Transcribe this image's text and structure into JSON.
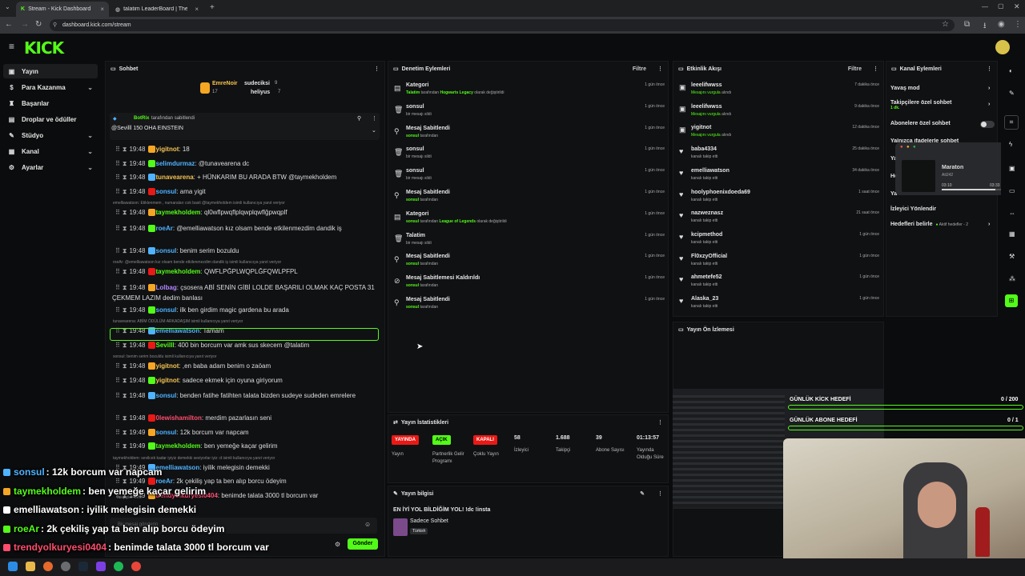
{
  "browser": {
    "tabs": [
      {
        "title": "Stream - Kick Dashboard",
        "active": true
      },
      {
        "title": "talatim LeaderBoard | The best",
        "active": false
      }
    ],
    "url": "dashboard.kick.com/stream"
  },
  "header": {
    "logo": "KICK"
  },
  "sidebar": {
    "items": [
      {
        "label": "Yayın",
        "icon": "video-icon",
        "active": true,
        "chevron": false
      },
      {
        "label": "Para Kazanma",
        "icon": "money-icon",
        "chevron": true
      },
      {
        "label": "Başarılar",
        "icon": "trophy-icon",
        "chevron": false
      },
      {
        "label": "Droplar ve ödüller",
        "icon": "gift-icon",
        "chevron": false
      },
      {
        "label": "Stüdyo",
        "icon": "studio-icon",
        "chevron": true
      },
      {
        "label": "Kanal",
        "icon": "channel-icon",
        "chevron": true
      },
      {
        "label": "Ayarlar",
        "icon": "settings-icon",
        "chevron": true
      }
    ]
  },
  "chat": {
    "title": "Sohbet",
    "leaderboard": [
      {
        "name": "EmreNoir",
        "value": "17"
      },
      {
        "name": "sudeciksi",
        "value": "9"
      },
      {
        "name": "heliyus",
        "value": "7"
      }
    ],
    "pinned": {
      "bot": "BotRix",
      "by": "tarafından sabitlendi",
      "text": "@Sevilll 150 OHA EINSTEIN"
    },
    "messages": [
      {
        "time": "19:48",
        "user": "yigitnot",
        "color": "#f5c451",
        "text": "18",
        "reply": ""
      },
      {
        "time": "19:48",
        "user": "selimdurmaz",
        "color": "#4fb3ff",
        "text": "@tunavearena dc",
        "reply": ""
      },
      {
        "time": "19:48",
        "user": "tunavearena",
        "color": "#f5c451",
        "text": "+ HÜNKARIM BU ARADA BTW @taymekholdem",
        "reply": ""
      },
      {
        "time": "19:48",
        "user": "sonsul",
        "color": "#4fb3ff",
        "text": "ama yigit",
        "reply": ""
      },
      {
        "time": "19:48",
        "user": "taymekholdem",
        "color": "#53fc18",
        "text": "ql0wflpwqflplqwplqwflğpwqplf",
        "reply": "emelliawatson: Etiklenmem , numaraları cok basit @taymekholdem isimli kullanıcıya yanıt veriyor"
      },
      {
        "time": "19:48",
        "user": "roeAr",
        "color": "#4fb3ff",
        "text": "@emelliawatson kız olsam bende etkilenmezdim dandik iş",
        "reply": ""
      },
      {
        "time": "19:48",
        "user": "sonsul",
        "color": "#4fb3ff",
        "text": "benim serim bozuldu",
        "reply": ""
      },
      {
        "time": "19:48",
        "user": "taymekholdem",
        "color": "#53fc18",
        "text": "QWFLPĞPLWQPLĞFQWLPFPL",
        "reply": "roeAr: @emelliawatson kız olsam bende etkilenmezdim dandik iş isimli kullanıcıya yanıt veriyor"
      },
      {
        "time": "19:48",
        "user": "Lolbag",
        "color": "#b388ff",
        "text": "çsosera ABİ SENİN GİBİ LOLDE BAŞARILI OLMAK KAÇ POSTA 31 ÇEKMEM LAZIM dedim banlası",
        "reply": ""
      },
      {
        "time": "19:48",
        "user": "sonsul",
        "color": "#4fb3ff",
        "text": "ilk ben girdim magic gardena bu arada",
        "reply": ""
      },
      {
        "time": "19:48",
        "user": "emelliawatson",
        "color": "#4fb3ff",
        "text": "Tamam",
        "reply": "tunavearena: ABİM ÖDÜLÜM ARKADAŞIM isimli kullanıcıya yanıt veriyor"
      },
      {
        "time": "19:48",
        "user": "Sevilll",
        "color": "#53fc18",
        "text": "400 bin borcum var amk sus skecem @talatim",
        "reply": ""
      },
      {
        "time": "19:48",
        "user": "yigitnot",
        "color": "#f5c451",
        "text": ",en baba adam benim o zaöam",
        "reply": "sonsul: benim serim bozuldu isimli kullanıcıya yanıt veriyor"
      },
      {
        "time": "19:48",
        "user": "yigitnot",
        "color": "#f5c451",
        "text": "sadece ekmek için oyuna giriyorum",
        "reply": ""
      },
      {
        "time": "19:48",
        "user": "sonsul",
        "color": "#4fb3ff",
        "text": "benden fatihe fatihten talata bizden sudeye sudeden emrelere",
        "reply": ""
      },
      {
        "time": "19:48",
        "user": "0lewishamilton",
        "color": "#ff4d6d",
        "text": "merdim pazarlasın seni",
        "reply": ""
      },
      {
        "time": "19:49",
        "user": "sonsul",
        "color": "#4fb3ff",
        "text": "12k borcum var napcam",
        "reply": ""
      },
      {
        "time": "19:49",
        "user": "taymekholdem",
        "color": "#53fc18",
        "text": "ben yemeğe kaçar gelirim",
        "reply": ""
      },
      {
        "time": "19:49",
        "user": "emelliawatson",
        "color": "#4fb3ff",
        "text": "iyilik melegisin demekki",
        "reply": "taymekholdem: sevilcek kadar iyiyiz demekki seviyorlar iyiz :d isimli kullanıcıya yanıt veriyor"
      },
      {
        "time": "19:49",
        "user": "roeAr",
        "color": "#4fb3ff",
        "text": "2k çekiliş yap ta ben alıp borcu ödeyim",
        "reply": ""
      },
      {
        "time": "19:49",
        "user": "trendyolkuryesi0404",
        "color": "#ff4d6d",
        "text": "benimde talata 3000 tl borcum var",
        "reply": ""
      }
    ],
    "input_placeholder": "Bir mesaj gönderin",
    "send_label": "Gönder",
    "footer_user": "Takipçiler Özel"
  },
  "moderation": {
    "title": "Denetim Eylemleri",
    "filter": "Filtre",
    "rows": [
      {
        "icon": "category-icon",
        "action": "Kategori",
        "sub_user": "Talatim",
        "sub_text": "tarafından",
        "sub_extra": "Hogwarts Legacy",
        "sub_tail": "olarak değiştirildi",
        "time": "1 gün önce"
      },
      {
        "icon": "trash-icon",
        "action": "sonsul",
        "sub_user": "",
        "sub_text": "bir mesajı sildi",
        "sub_extra": "",
        "sub_tail": "",
        "time": "1 gün önce"
      },
      {
        "icon": "pin-icon",
        "action": "Mesaj Sabitlendi",
        "sub_user": "sonsul",
        "sub_text": "tarafından",
        "sub_extra": "",
        "sub_tail": "",
        "time": "1 gün önce"
      },
      {
        "icon": "trash-icon",
        "action": "sonsul",
        "sub_user": "",
        "sub_text": "bir mesajı sildi",
        "sub_extra": "",
        "sub_tail": "",
        "time": "1 gün önce"
      },
      {
        "icon": "trash-icon",
        "action": "sonsul",
        "sub_user": "",
        "sub_text": "bir mesajı sildi",
        "sub_extra": "",
        "sub_tail": "",
        "time": "1 gün önce"
      },
      {
        "icon": "pin-icon",
        "action": "Mesaj Sabitlendi",
        "sub_user": "sonsul",
        "sub_text": "tarafından",
        "sub_extra": "",
        "sub_tail": "",
        "time": "1 gün önce"
      },
      {
        "icon": "category-icon",
        "action": "Kategori",
        "sub_user": "sonsul",
        "sub_text": "tarafından",
        "sub_extra": "League of Legends",
        "sub_tail": "olarak değiştirildi",
        "time": "1 gün önce"
      },
      {
        "icon": "trash-icon",
        "action": "Talatim",
        "sub_user": "",
        "sub_text": "bir mesajı sildi",
        "sub_extra": "",
        "sub_tail": "",
        "time": "1 gün önce"
      },
      {
        "icon": "pin-icon",
        "action": "Mesaj Sabitlendi",
        "sub_user": "sonsul",
        "sub_text": "tarafından",
        "sub_extra": "",
        "sub_tail": "",
        "time": "1 gün önce"
      },
      {
        "icon": "unpin-icon",
        "action": "Mesaj Sabitlemesi Kaldırıldı",
        "sub_user": "sonsul",
        "sub_text": "tarafından",
        "sub_extra": "",
        "sub_tail": "",
        "time": "1 gün önce"
      },
      {
        "icon": "pin-icon",
        "action": "Mesaj Sabitlendi",
        "sub_user": "sonsul",
        "sub_text": "tarafından",
        "sub_extra": "",
        "sub_tail": "",
        "time": "1 gün önce"
      }
    ]
  },
  "activity": {
    "title": "Etkinlik Akışı",
    "filter": "Filtre",
    "rows": [
      {
        "icon": "message-icon",
        "user": "leeelifwwss",
        "sub": "Mesajını vurgula",
        "sub_tail": "alındı",
        "time": "7 dakika önce"
      },
      {
        "icon": "message-icon",
        "user": "leeelifwwss",
        "sub": "Mesajını vurgula",
        "sub_tail": "alındı",
        "time": "9 dakika önce"
      },
      {
        "icon": "message-icon",
        "user": "yigitnot",
        "sub": "Mesajını vurgula",
        "sub_tail": "alındı",
        "time": "12 dakika önce"
      },
      {
        "icon": "heart-icon",
        "user": "baba4334",
        "sub": "",
        "sub_tail": "kanalı takip etti",
        "time": "25 dakika önce"
      },
      {
        "icon": "heart-icon",
        "user": "emelliawatson",
        "sub": "",
        "sub_tail": "kanalı takip etti",
        "time": "34 dakika önce"
      },
      {
        "icon": "heart-icon",
        "user": "hoolyphoenixdoeda69",
        "sub": "",
        "sub_tail": "kanalı takip etti",
        "time": "1 saat önce"
      },
      {
        "icon": "heart-icon",
        "user": "nazweznasz",
        "sub": "",
        "sub_tail": "kanalı takip etti",
        "time": "21 saat önce"
      },
      {
        "icon": "heart-icon",
        "user": "kcipmethod",
        "sub": "",
        "sub_tail": "kanalı takip etti",
        "time": "1 gün önce"
      },
      {
        "icon": "heart-icon",
        "user": "Fl0xzyOfficial",
        "sub": "",
        "sub_tail": "kanalı takip etti",
        "time": "1 gün önce"
      },
      {
        "icon": "heart-icon",
        "user": "ahmetefe52",
        "sub": "",
        "sub_tail": "kanalı takip etti",
        "time": "1 gün önce"
      },
      {
        "icon": "heart-icon",
        "user": "Alaska_23",
        "sub": "",
        "sub_tail": "kanalı takip etti",
        "time": "1 gün önce"
      }
    ]
  },
  "channel_actions": {
    "title": "Kanal Eylemleri",
    "items": [
      {
        "label": "Yavaş mod",
        "sub": "",
        "control": "chevron"
      },
      {
        "label": "Takipçilere özel sohbet",
        "sub": "1 dk.",
        "control": "chevron"
      },
      {
        "label": "Abonelere özel sohbet",
        "sub": "",
        "control": "toggle"
      },
      {
        "label": "Yalnızca ifadelerle sohbet",
        "sub": "",
        "control": "toggle"
      },
      {
        "label": "İzleyici Yönlendir",
        "sub": "",
        "control": ""
      },
      {
        "label": "Hedefleri belirle",
        "sub": "Aktif hedefler - 2",
        "control": "chevron"
      }
    ]
  },
  "music": {
    "title": "Maraton",
    "artist": "Ati242",
    "elapsed": "03:10",
    "total": "03:33",
    "progress": 0.88
  },
  "preview": {
    "title": "Yayın Ön İzlemesi"
  },
  "stats": {
    "title": "Yayın İstatistikleri",
    "items": [
      {
        "pill": "YAYINDA",
        "pill_color": "#e91916",
        "label": "Yayın"
      },
      {
        "pill": "AÇIK",
        "pill_color": "#53fc18",
        "label": "Partnerlik Gelir Programı"
      },
      {
        "pill": "KAPALI",
        "pill_color": "#e91916",
        "label": "Çoklu Yayın"
      },
      {
        "value": "58",
        "label": "İzleyici"
      },
      {
        "value": "1.688",
        "label": "Takipçi"
      },
      {
        "value": "39",
        "label": "Abone Sayısı"
      },
      {
        "value": "01:13:57",
        "label": "Yayında Olduğu Süre"
      }
    ]
  },
  "stream_info": {
    "title": "Yayın bilgisi",
    "stream_title": "EN İYİ YOL BİLDİĞİM YOL! !dc !insta",
    "category": "Sadece Sohbet",
    "tag": "Türkish"
  },
  "goals": [
    {
      "label": "GÜNLÜK KİCK HEDEFİ",
      "value": "0 / 200"
    },
    {
      "label": "GÜNLÜK ABONE HEDEFİ",
      "value": "0 / 1"
    }
  ],
  "overlay_chat": [
    {
      "user": "sonsul",
      "color": "#4fb3ff",
      "text": ": 12k borcum var napcam"
    },
    {
      "user": "taymekholdem",
      "color": "#53fc18",
      "text": ": ben yemeğe kaçar gelirim"
    },
    {
      "user": "emelliawatson",
      "color": "#ffffff",
      "text": ": iyilik melegisin demekki"
    },
    {
      "user": "roeAr",
      "color": "#53fc18",
      "text": ": 2k çekiliş yap ta ben alıp borcu ödeyim"
    },
    {
      "user": "trendyolkuryesi0404",
      "color": "#ff4d6d",
      "text": ": benimde talata 3000 tl borcum var"
    }
  ],
  "colors": {
    "accent": "#53fc18",
    "bg": "#0b0c0d",
    "panel": "#101113"
  }
}
